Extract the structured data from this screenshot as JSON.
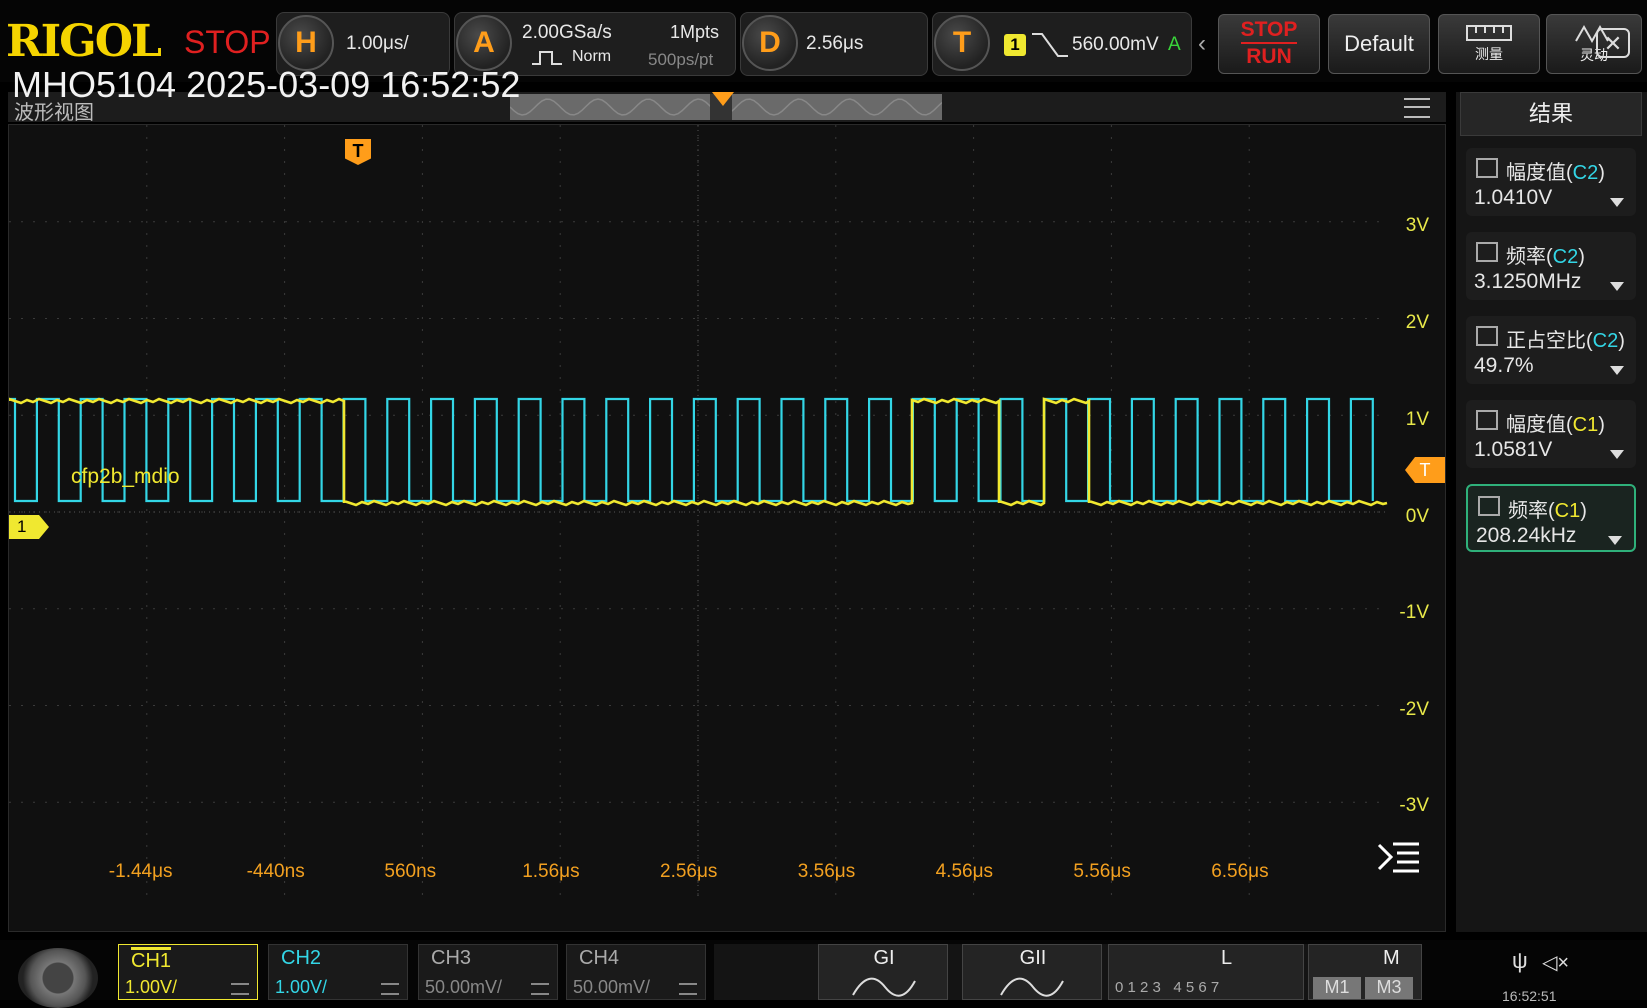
{
  "header": {
    "brand": "RIGOL",
    "run_state": "STOP",
    "horizontal": {
      "badge": "H",
      "timebase": "1.00μs/"
    },
    "acquire": {
      "badge": "A",
      "sample_rate": "2.00GSa/s",
      "mode": "Norm",
      "memory_depth": "1Mpts",
      "resolution": "500ps/pt"
    },
    "delay": {
      "badge": "D",
      "value": "2.56μs"
    },
    "trigger": {
      "badge": "T",
      "source": "1",
      "level": "560.00mV",
      "sweep": "A"
    },
    "stop_run": {
      "stop": "STOP",
      "run": "RUN"
    },
    "default_label": "Default",
    "measure_label": "测量",
    "trace_label": "灵动"
  },
  "overlay": {
    "model_timestamp": "MHO5104 2025-03-09 16:52:52"
  },
  "waveform_view": {
    "title": "波形视图",
    "channel1_label": "cfp2b_mdio",
    "ch1_marker": "1",
    "trigger_marker": "T"
  },
  "y_axis": {
    "ticks": [
      "3V",
      "2V",
      "1V",
      "0V",
      "-1V",
      "-2V",
      "-3V"
    ]
  },
  "x_axis": {
    "ticks": [
      "-1.44μs",
      "-440ns",
      "560ns",
      "1.56μs",
      "2.56μs",
      "3.56μs",
      "4.56μs",
      "5.56μs",
      "6.56μs"
    ]
  },
  "results_panel": {
    "title": "结果",
    "items": [
      {
        "name": "幅度值",
        "ch": "C2",
        "value": "1.0410V",
        "ch_color": "#33d6e6"
      },
      {
        "name": "频率",
        "ch": "C2",
        "value": "3.1250MHz",
        "ch_color": "#33d6e6"
      },
      {
        "name": "正占空比",
        "ch": "C2",
        "value": "49.7%",
        "ch_color": "#33d6e6"
      },
      {
        "name": "幅度值",
        "ch": "C1",
        "value": "1.0581V",
        "ch_color": "#f0e830"
      },
      {
        "name": "频率",
        "ch": "C1",
        "value": "208.24kHz",
        "ch_color": "#f0e830"
      }
    ]
  },
  "channels": [
    {
      "name": "CH1",
      "scale": "1.00V/",
      "color": "#f0e830"
    },
    {
      "name": "CH2",
      "scale": "1.00V/",
      "color": "#33d6e6"
    },
    {
      "name": "CH3",
      "scale": "50.00mV/",
      "color": "#888888"
    },
    {
      "name": "CH4",
      "scale": "50.00mV/",
      "color": "#888888"
    }
  ],
  "bottom_tabs": {
    "g1": "GI",
    "g2": "GII",
    "l": "L",
    "l_digits": "0 1 2 3   4 5 6 7",
    "m": "M",
    "m1": "M1",
    "m3": "M3",
    "clock": "16:52:51"
  },
  "colors": {
    "ch1": "#f0e830",
    "ch2": "#33d6e6",
    "accent": "#ff9d1a",
    "stop_red": "#e02020"
  }
}
